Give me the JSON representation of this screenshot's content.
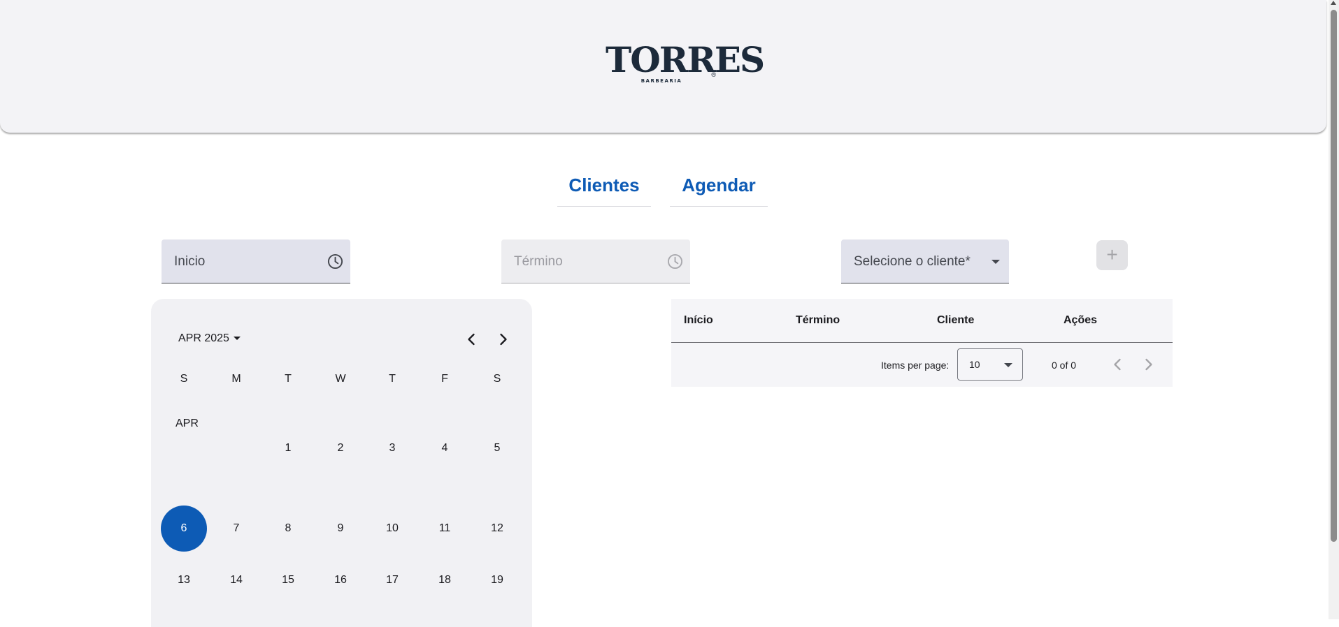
{
  "header": {
    "logo_text": "TORRES",
    "logo_subtext": "BARBEARIA",
    "logo_reg": "®"
  },
  "tabs": [
    {
      "label": "Clientes"
    },
    {
      "label": "Agendar"
    }
  ],
  "form": {
    "inicio_label": "Inicio",
    "termino_label": "Término",
    "cliente_label": "Selecione o cliente*",
    "add_label": "+"
  },
  "calendar": {
    "period_label": "APR 2025",
    "month_label": "APR",
    "weekdays": [
      "S",
      "M",
      "T",
      "W",
      "T",
      "F",
      "S"
    ],
    "selected_day": "6",
    "week1": [
      "1",
      "2",
      "3",
      "4",
      "5"
    ],
    "week2": [
      "6",
      "7",
      "8",
      "9",
      "10",
      "11",
      "12"
    ],
    "week3": [
      "13",
      "14",
      "15",
      "16",
      "17",
      "18",
      "19"
    ]
  },
  "table": {
    "columns": [
      "Início",
      "Término",
      "Cliente",
      "Ações"
    ],
    "items_per_page_label": "Items per page:",
    "page_size": "10",
    "range_label": "0 of 0"
  },
  "colors": {
    "accent": "#0e5bb5",
    "header_bg": "#f3f3f6",
    "logo": "#1c2a3a"
  }
}
